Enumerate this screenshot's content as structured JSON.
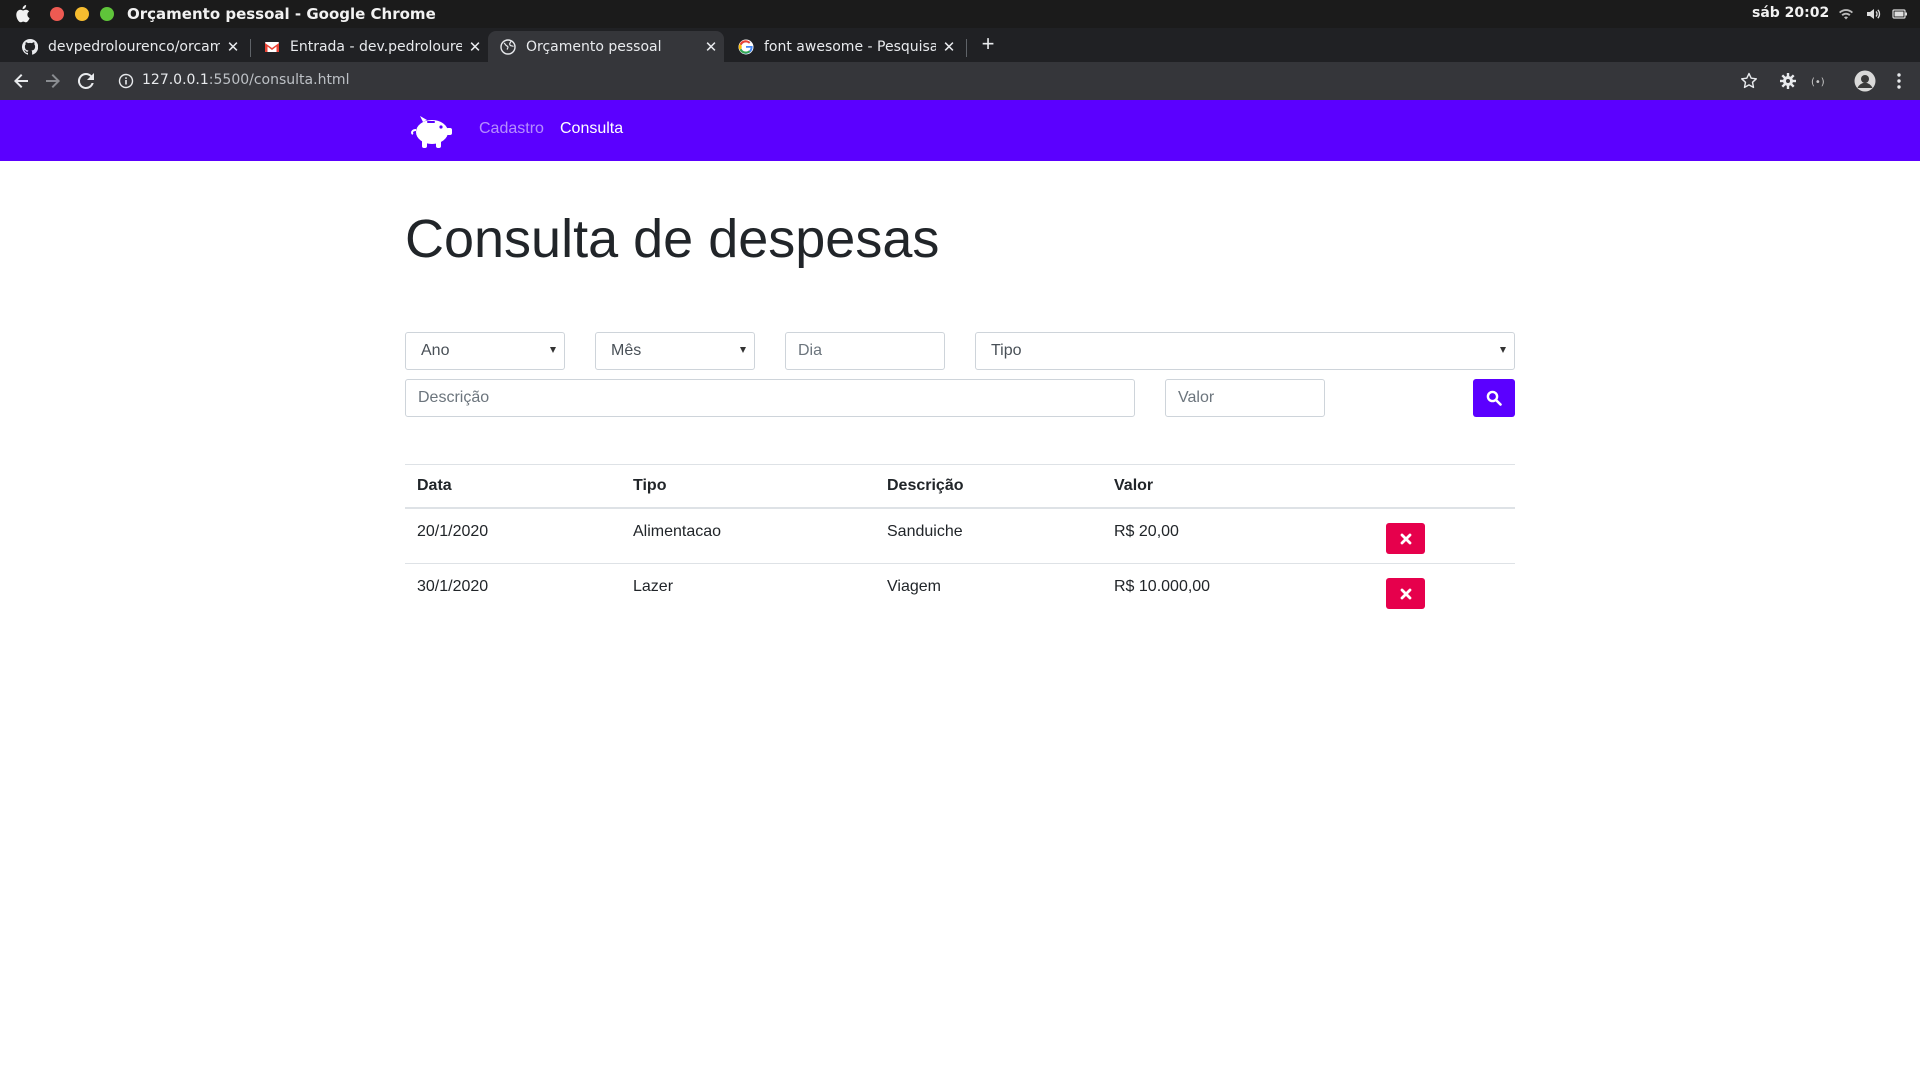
{
  "os": {
    "window_title": "Orçamento pessoal - Google Chrome",
    "clock": "sáb 20:02"
  },
  "browser": {
    "tabs": [
      {
        "label": "devpedrolourenco/orcamento",
        "icon": "github-icon",
        "active": false
      },
      {
        "label": "Entrada - dev.pedrolourenco",
        "icon": "gmail-icon",
        "active": false
      },
      {
        "label": "Orçamento pessoal",
        "icon": "globe-icon",
        "active": true
      },
      {
        "label": "font awesome - Pesquisa Google",
        "icon": "google-icon",
        "active": false
      }
    ],
    "url_host": "127.0.0.1",
    "url_rest": ":5500/consulta.html"
  },
  "navbar": {
    "brand_icon": "piggy-bank-icon",
    "links": [
      {
        "label": "Cadastro",
        "active": false
      },
      {
        "label": "Consulta",
        "active": true
      }
    ]
  },
  "page": {
    "title": "Consulta de despesas"
  },
  "filters": {
    "ano": "Ano",
    "mes": "Mês",
    "dia_placeholder": "Dia",
    "tipo": "Tipo",
    "descricao_placeholder": "Descrição",
    "valor_placeholder": "Valor"
  },
  "table": {
    "headers": [
      "Data",
      "Tipo",
      "Descrição",
      "Valor"
    ],
    "rows": [
      {
        "data": "20/1/2020",
        "tipo": "Alimentacao",
        "descricao": "Sanduiche",
        "valor": "R$ 20,00"
      },
      {
        "data": "30/1/2020",
        "tipo": "Lazer",
        "descricao": "Viagem",
        "valor": "R$ 10.000,00"
      }
    ]
  },
  "colors": {
    "accent": "#5b00ff",
    "danger": "#e6004c"
  }
}
